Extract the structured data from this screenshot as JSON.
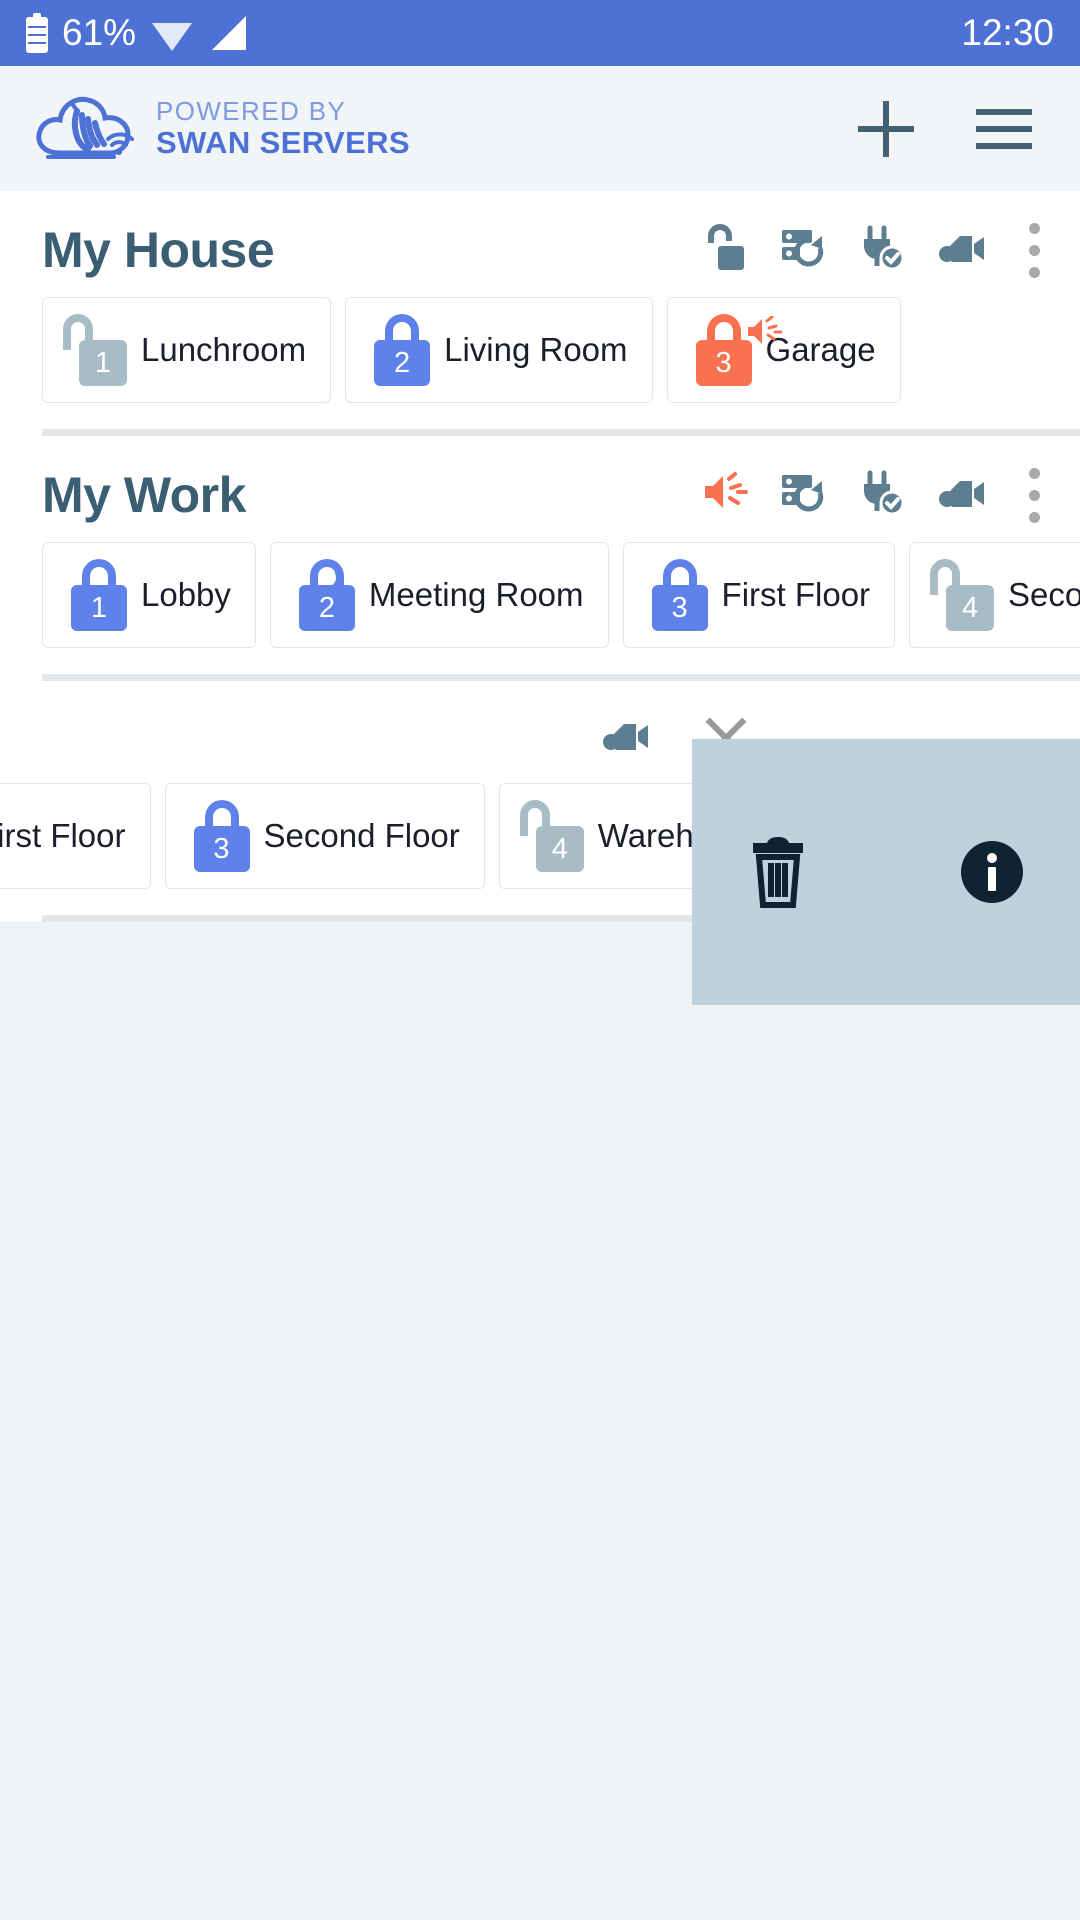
{
  "status_bar": {
    "battery_percent": "61%",
    "time": "12:30",
    "battery_icon": "battery-icon",
    "wifi_icon": "wifi-icon",
    "signal_icon": "cellular-signal-icon",
    "background_color": "#4d71d4"
  },
  "app_bar": {
    "logo_icon": "swan-cloud-logo-icon",
    "powered_by": "POWERED BY",
    "brand_name": "SWAN SERVERS",
    "add_label": "plus-icon",
    "menu_label": "hamburger-menu-icon",
    "brand_color": "#4d71d4",
    "powered_color": "#7f9ae0"
  },
  "sections": [
    {
      "title": "My House",
      "icons": [
        {
          "name": "unlock-all-icon",
          "color": "#5d7d90"
        },
        {
          "name": "server-refresh-icon",
          "color": "#5d7d90"
        },
        {
          "name": "plug-check-icon",
          "color": "#5d7d90"
        },
        {
          "name": "video-camera-icon",
          "color": "#5d7d90"
        }
      ],
      "kebab": "more-options-icon",
      "chips": [
        {
          "number": "1",
          "label": "Lunchroom",
          "state": "unlocked",
          "color": "#a8bcc6",
          "alarm": false,
          "night": false
        },
        {
          "number": "2",
          "label": "Living Room",
          "state": "locked",
          "color": "#5f82ea",
          "alarm": false,
          "night": false
        },
        {
          "number": "3",
          "label": "Garage",
          "state": "locked",
          "color": "#f9714e",
          "alarm": true,
          "night": false
        }
      ]
    },
    {
      "title": "My Work",
      "icons": [
        {
          "name": "alarm-siren-icon",
          "color": "#f9714e"
        },
        {
          "name": "server-refresh-icon",
          "color": "#5d7d90"
        },
        {
          "name": "plug-check-icon",
          "color": "#5d7d90"
        },
        {
          "name": "video-camera-icon",
          "color": "#5d7d90"
        }
      ],
      "kebab": "more-options-icon",
      "chips": [
        {
          "number": "1",
          "label": "Lobby",
          "state": "locked",
          "color": "#5f82ea",
          "alarm": false,
          "night": false
        },
        {
          "number": "2",
          "label": "Meeting Room",
          "state": "locked",
          "color": "#5f82ea",
          "alarm": false,
          "night": true
        },
        {
          "number": "3",
          "label": "First Floor",
          "state": "locked",
          "color": "#5f82ea",
          "alarm": false,
          "night": false
        },
        {
          "number": "4",
          "label": "Second Floor",
          "state": "unlocked",
          "color": "#a8bcc6",
          "alarm": false,
          "night": false
        }
      ]
    },
    {
      "title": "",
      "icons": [
        {
          "name": "video-camera-icon",
          "color": "#5d7d90"
        }
      ],
      "close": "close-icon",
      "chips": [
        {
          "number": "",
          "label": "First Floor",
          "state": "locked",
          "color": "#5f82ea",
          "alarm": false,
          "night": false
        },
        {
          "number": "3",
          "label": "Second Floor",
          "state": "locked",
          "color": "#5f82ea",
          "alarm": false,
          "night": false
        },
        {
          "number": "4",
          "label": "Warehouse",
          "state": "unlocked",
          "color": "#a8bcc6",
          "alarm": false,
          "night": false
        }
      ]
    }
  ],
  "overlay": {
    "background_color": "#bdd2dc",
    "delete_icon": "trash-icon",
    "info_icon": "info-icon",
    "icon_color": "#0f2330"
  }
}
